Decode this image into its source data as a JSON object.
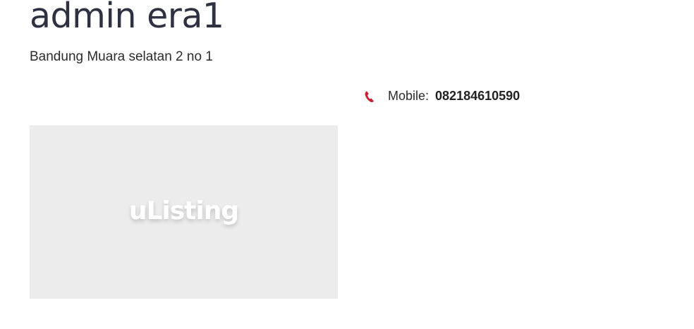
{
  "agent": {
    "name": "admin era1",
    "address": "Bandung Muara selatan 2 no 1"
  },
  "contact": {
    "icon": "phone-icon",
    "icon_color": "#c8202f",
    "mobile_label": "Mobile:",
    "mobile_value": "082184610590"
  },
  "image_placeholder": {
    "logo_text": "uListing",
    "background": "#ececec"
  }
}
